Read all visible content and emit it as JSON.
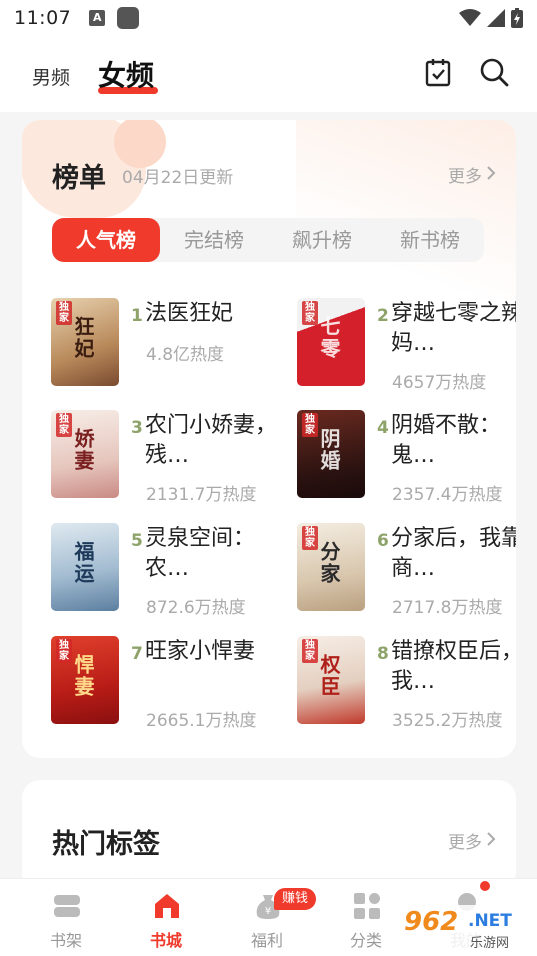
{
  "status_bar": {
    "time": "11:07",
    "a_icon_letter": "A"
  },
  "header": {
    "tab_male": "男频",
    "tab_female": "女频",
    "icons": [
      "calendar-check-icon",
      "search-icon"
    ]
  },
  "ranking": {
    "title": "榜单",
    "updated": "04月22日更新",
    "more": "更多",
    "tabs": [
      "人气榜",
      "完结榜",
      "飙升榜",
      "新书榜"
    ],
    "active_tab": "人气榜",
    "books": [
      {
        "rank": "1",
        "title": "法医狂妃",
        "heat": "4.8亿热度",
        "badge": "独家",
        "cover_text": "狂妃",
        "cover_color": "#c9a67a"
      },
      {
        "rank": "2",
        "title": "穿越七零之辣妈…",
        "heat": "4657万热度",
        "badge": "独家",
        "cover_text": "七零",
        "cover_color": "#c8202a"
      },
      {
        "rank": "3",
        "title": "农门小娇妻，残…",
        "heat": "2131.7万热度",
        "badge": "独家",
        "cover_text": "娇妻",
        "cover_color": "#e8d7cf"
      },
      {
        "rank": "4",
        "title": "阴婚不散：鬼…",
        "heat": "2357.4万热度",
        "badge": "独家",
        "cover_text": "阴婚",
        "cover_color": "#4a1f1a"
      },
      {
        "rank": "5",
        "title": "灵泉空间：农…",
        "heat": "872.6万热度",
        "badge": "",
        "cover_text": "福运",
        "cover_color": "#a9c3d8"
      },
      {
        "rank": "6",
        "title": "分家后，我靠商…",
        "heat": "2717.8万热度",
        "badge": "独家",
        "cover_text": "分家",
        "cover_color": "#e6d9c8"
      },
      {
        "rank": "7",
        "title": "旺家小悍妻",
        "heat": "2665.1万热度",
        "badge": "独家",
        "cover_text": "悍妻",
        "cover_color": "#c4281e"
      },
      {
        "rank": "8",
        "title": "错撩权臣后，我…",
        "heat": "3525.2万热度",
        "badge": "独家",
        "cover_text": "权臣",
        "cover_color": "#e9ddd3"
      }
    ]
  },
  "tags": {
    "title": "热门标签",
    "more": "更多"
  },
  "bottom_nav": {
    "items": [
      "书架",
      "书城",
      "福利",
      "分类",
      "我的"
    ],
    "active": "书城",
    "earn_badge": "赚钱"
  },
  "watermark": {
    "logo": "962",
    "net": ".NET",
    "sub": "乐游网"
  },
  "colors": {
    "accent": "#ef3a2c",
    "rank_number": "#8ea36a"
  }
}
